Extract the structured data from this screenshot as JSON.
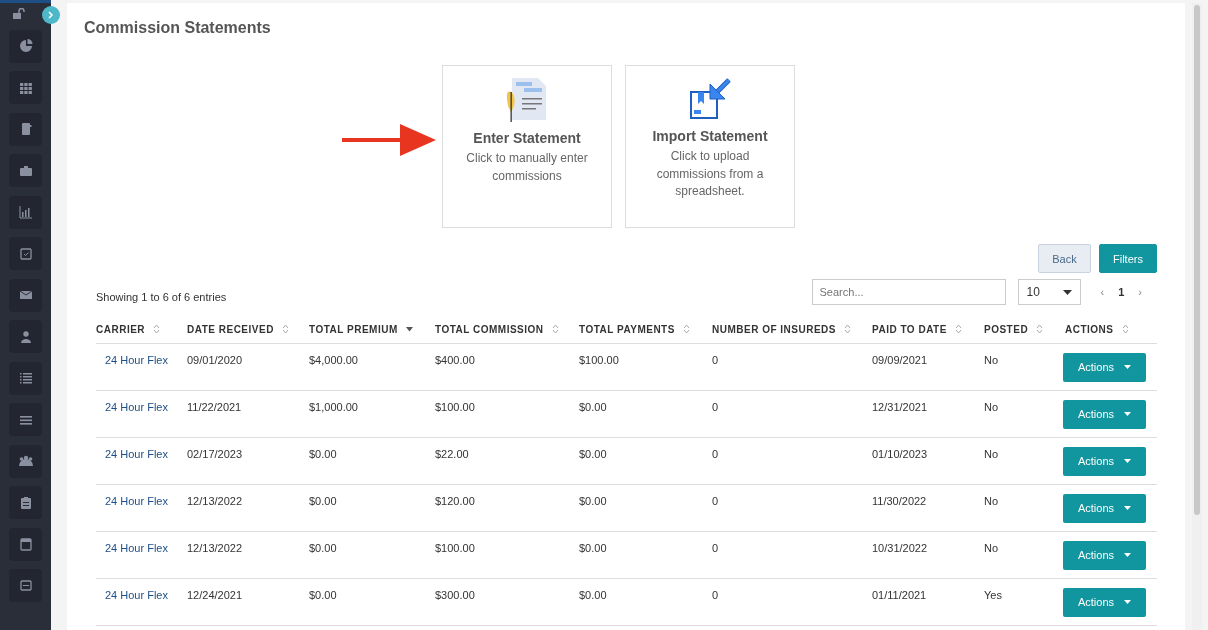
{
  "page": {
    "title": "Commission Statements"
  },
  "options": [
    {
      "kind": "enter",
      "title": "Enter Statement",
      "description": "Click to manually enter commissions"
    },
    {
      "kind": "import",
      "title": "Import Statement",
      "description": "Click to upload commissions from a spreadsheet."
    }
  ],
  "buttons": {
    "back": "Back",
    "filters": "Filters"
  },
  "table_info": "Showing 1 to 6 of 6 entries",
  "search": {
    "placeholder": "Search..."
  },
  "page_size": "10",
  "pagination": {
    "prev": "‹",
    "page": "1",
    "next": "›"
  },
  "table": {
    "columns": [
      {
        "label": "CARRIER",
        "sorted": false
      },
      {
        "label": "DATE RECEIVED",
        "sorted": false
      },
      {
        "label": "TOTAL PREMIUM",
        "sorted": true
      },
      {
        "label": "TOTAL COMMISSION",
        "sorted": false
      },
      {
        "label": "TOTAL PAYMENTS",
        "sorted": false
      },
      {
        "label": "NUMBER OF INSUREDS",
        "sorted": false
      },
      {
        "label": "PAID TO DATE",
        "sorted": false
      },
      {
        "label": "POSTED",
        "sorted": false
      },
      {
        "label": "ACTIONS",
        "sorted": false
      }
    ],
    "rows": [
      {
        "cells": [
          "24 Hour Flex",
          "09/01/2020",
          "$4,000.00",
          "$400.00",
          "$100.00",
          "0",
          "09/09/2021",
          "No",
          "Actions"
        ]
      },
      {
        "cells": [
          "24 Hour Flex",
          "11/22/2021",
          "$1,000.00",
          "$100.00",
          "$0.00",
          "0",
          "12/31/2021",
          "No",
          "Actions"
        ]
      },
      {
        "cells": [
          "24 Hour Flex",
          "02/17/2023",
          "$0.00",
          "$22.00",
          "$0.00",
          "0",
          "01/10/2023",
          "No",
          "Actions"
        ]
      },
      {
        "cells": [
          "24 Hour Flex",
          "12/13/2022",
          "$0.00",
          "$120.00",
          "$0.00",
          "0",
          "11/30/2022",
          "No",
          "Actions"
        ]
      },
      {
        "cells": [
          "24 Hour Flex",
          "12/13/2022",
          "$0.00",
          "$100.00",
          "$0.00",
          "0",
          "10/31/2022",
          "No",
          "Actions"
        ]
      },
      {
        "cells": [
          "24 Hour Flex",
          "12/24/2021",
          "$0.00",
          "$300.00",
          "$0.00",
          "0",
          "01/11/2021",
          "Yes",
          "Actions"
        ]
      }
    ]
  }
}
